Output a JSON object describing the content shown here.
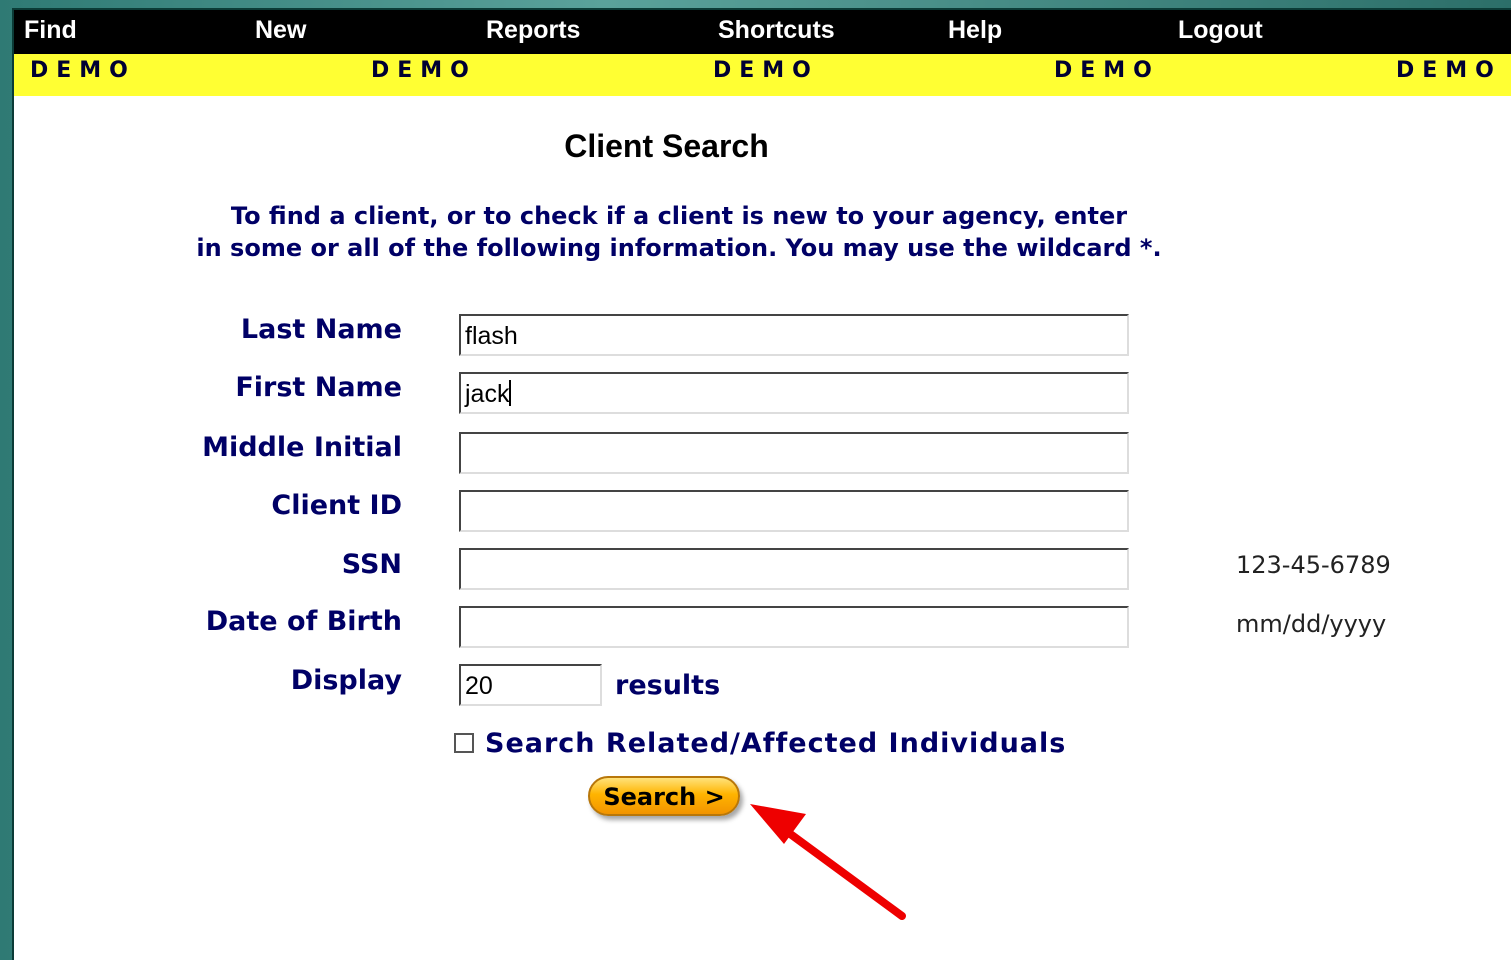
{
  "menu": {
    "items": [
      "Find",
      "New",
      "Reports",
      "Shortcuts",
      "Help",
      "Logout"
    ]
  },
  "banner": {
    "words": [
      "DEMO",
      "DEMO",
      "DEMO",
      "DEMO",
      "DEMO"
    ],
    "color": "#ffff33"
  },
  "page": {
    "title": "Client Search",
    "instructions_line1": "To find a client, or to check if a client is new to your agency, enter",
    "instructions_line2": "in some or all of the following information. You may use the wildcard *."
  },
  "form": {
    "last_name": {
      "label": "Last Name",
      "value": "flash"
    },
    "first_name": {
      "label": "First Name",
      "value": "jack"
    },
    "middle_initial": {
      "label": "Middle Initial",
      "value": ""
    },
    "client_id": {
      "label": "Client ID",
      "value": ""
    },
    "ssn": {
      "label": "SSN",
      "value": "",
      "hint": "123-45-6789"
    },
    "dob": {
      "label": "Date of Birth",
      "value": "",
      "hint": "mm/dd/yyyy"
    },
    "display": {
      "label": "Display",
      "value": "20",
      "suffix": "results"
    },
    "related_checkbox": {
      "label": "Search Related/Affected Individuals",
      "checked": false
    },
    "search_button": {
      "label": "Search >"
    }
  },
  "colors": {
    "accent_label": "#000066",
    "button": "#ffb400",
    "arrow": "#ee0000"
  },
  "icons": {
    "annotation": "red-arrow-icon"
  }
}
